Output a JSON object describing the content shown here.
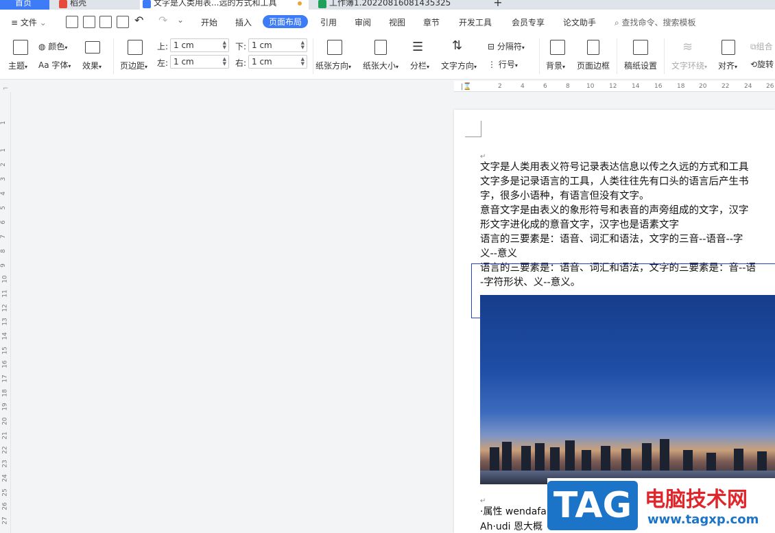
{
  "tabs": [
    {
      "label": "首页"
    },
    {
      "label": "稻壳"
    },
    {
      "label": "文字是人类用表...远的方式和工具"
    },
    {
      "label": "工作簿1.20220816081435325"
    }
  ],
  "tab_add": "+",
  "menu": {
    "file": "文件",
    "items": [
      "开始",
      "插入",
      "页面布局",
      "引用",
      "审阅",
      "视图",
      "章节",
      "开发工具",
      "会员专享",
      "论文助手"
    ],
    "search": "查找命令、搜索模板"
  },
  "ribbon": {
    "theme": "主题",
    "color": "颜色",
    "font": "字体",
    "effect": "效果",
    "margin": "页边距",
    "top_label": "上:",
    "top_value": "1 cm",
    "left_label": "左:",
    "left_value": "1 cm",
    "bottom_label": "下:",
    "bottom_value": "1 cm",
    "right_label": "右:",
    "right_value": "1 cm",
    "orientation": "纸张方向",
    "size": "纸张大小",
    "columns": "分栏",
    "text_direction": "文字方向",
    "separator": "分隔符",
    "line_number": "行号",
    "background": "背景",
    "page_border": "页面边框",
    "paper_setting": "稿纸设置",
    "wrap": "文字环绕",
    "align": "对齐",
    "group": "组合",
    "rotate": "旋转"
  },
  "ruler_ticks": [
    "2",
    "4",
    "6",
    "8",
    "10",
    "12",
    "14",
    "16",
    "18",
    "20",
    "22",
    "24",
    "26"
  ],
  "vruler_ticks": [
    "1",
    "1",
    "2",
    "3",
    "4",
    "5",
    "6",
    "7",
    "8",
    "9",
    "10",
    "11",
    "12",
    "13",
    "14",
    "15",
    "16",
    "17",
    "18",
    "19",
    "20",
    "21",
    "22",
    "23",
    "24",
    "25",
    "26",
    "27"
  ],
  "doc": {
    "lines": [
      "文字是人类用表义符号记录表达信息以传之久远的方式和工具",
      "文字多是记录语言的工具，人类往往先有口头的语言后产生书",
      "字，很多小语种，有语言但没有文字。",
      "意音文字是由表义的象形符号和表音的声旁组成的文字，汉字",
      "形文字进化成的意音文字，汉字也是语素文字",
      "语言的三要素是：语音、词汇和语法，文字的三音--语音--字",
      "义--意义",
      "语言的三要素是：语音、词汇和语法，文字的三要素是：音--语",
      "-字符形状、义--意义。"
    ],
    "bottom_line1": "·属性 wendafa",
    "bottom_line2": "Ah·udi 恩大概"
  },
  "watermark": {
    "tag": "TAG",
    "cn": "电脑技术网",
    "url": "www.tagxp.com"
  },
  "colors": {
    "accent": "#3d7bf7",
    "selection": "#2440c8",
    "watermark_red": "#e0262a",
    "watermark_blue": "#1b74c7"
  }
}
